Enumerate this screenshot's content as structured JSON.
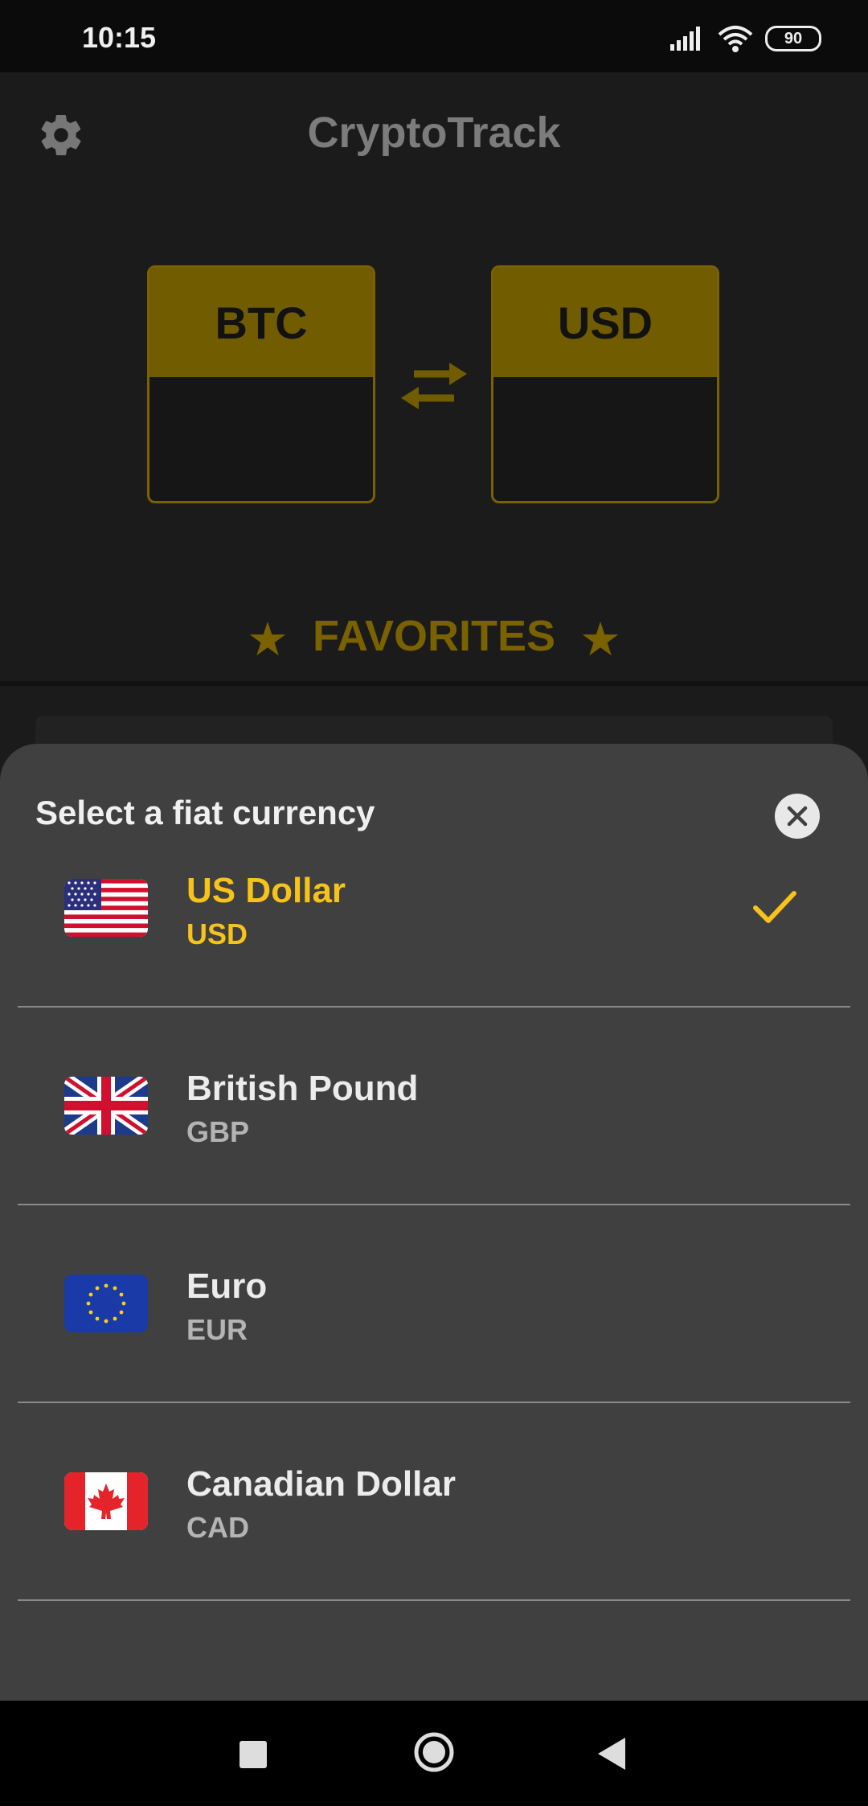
{
  "status_bar": {
    "time": "10:15",
    "battery": "90"
  },
  "app": {
    "title": "CryptoTrack",
    "from_currency": "BTC",
    "to_currency": "USD",
    "favorites_label": "FAVORITES",
    "accent_color": "#f7c21a"
  },
  "sheet": {
    "title": "Select a fiat currency",
    "items": [
      {
        "name": "US Dollar",
        "code": "USD",
        "flag": "us-flag",
        "selected": true
      },
      {
        "name": "British Pound",
        "code": "GBP",
        "flag": "uk-flag",
        "selected": false
      },
      {
        "name": "Euro",
        "code": "EUR",
        "flag": "eu-flag",
        "selected": false
      },
      {
        "name": "Canadian Dollar",
        "code": "CAD",
        "flag": "canada-flag",
        "selected": false
      }
    ]
  }
}
